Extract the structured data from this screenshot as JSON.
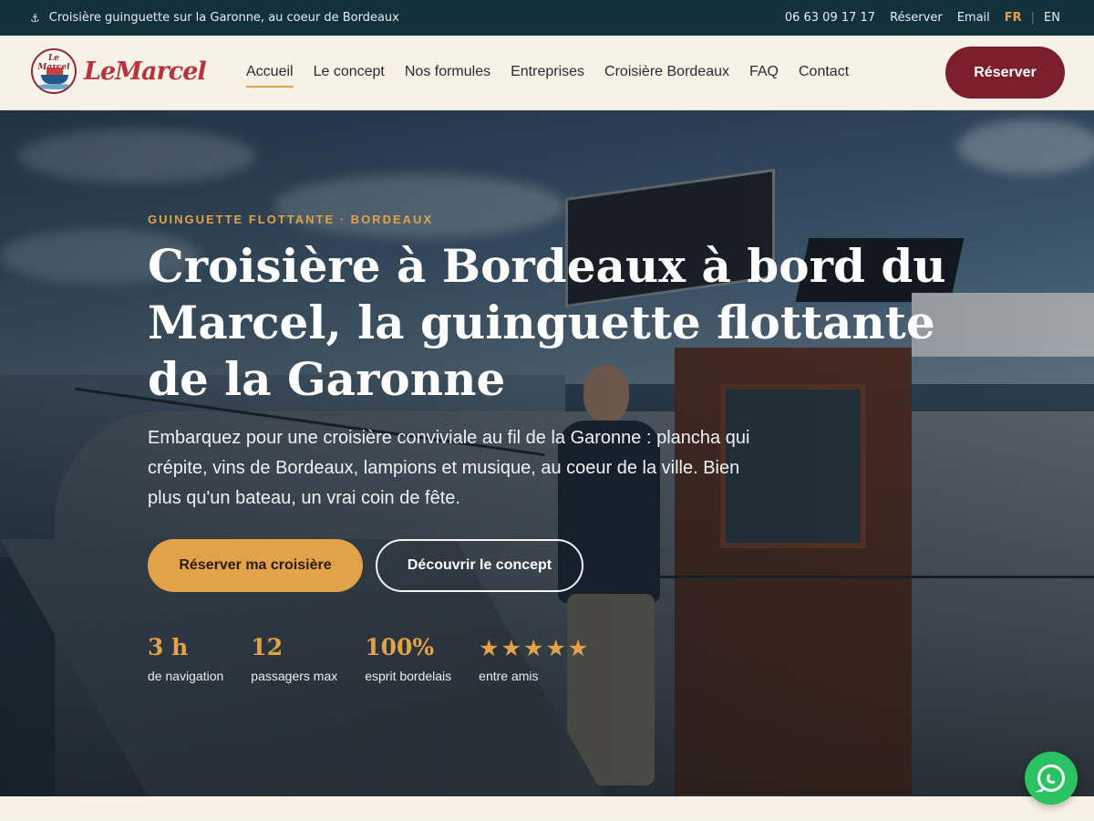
{
  "topbar": {
    "tagline": "Croisière guinguette sur la Garonne, au coeur de Bordeaux",
    "phone": "06 63 09 17 17",
    "reserve_link": "Réserver",
    "email_link": "Email",
    "lang_fr": "FR",
    "lang_sep": "|",
    "lang_en": "EN"
  },
  "header": {
    "logo_text": "LeMarcel",
    "logo_badge_text": "Le Marcel",
    "nav": [
      {
        "label": "Accueil",
        "active": true
      },
      {
        "label": "Le concept"
      },
      {
        "label": "Nos formules"
      },
      {
        "label": "Entreprises"
      },
      {
        "label": "Croisière Bordeaux"
      },
      {
        "label": "FAQ"
      },
      {
        "label": "Contact"
      }
    ],
    "cta": "Réserver"
  },
  "hero": {
    "eyebrow": "GUINGUETTE FLOTTANTE · BORDEAUX",
    "title": "Croisière à Bordeaux à bord du Marcel, la guinguette flottante de la Garonne",
    "subtitle": "Embarquez pour une croisière conviviale au fil de la Garonne : plancha qui crépite, vins de Bordeaux, lampions et musique, au coeur de la ville. Bien plus qu'un bateau, un vrai coin de fête.",
    "primary_cta": "Réserver ma croisière",
    "secondary_cta": "Découvrir le concept",
    "stats": [
      {
        "value": "3 h",
        "label": "de navigation"
      },
      {
        "value": "12",
        "label": "passagers max"
      },
      {
        "value": "100%",
        "label": "esprit bordelais"
      }
    ],
    "rating": {
      "stars": 5,
      "label": "entre amis"
    }
  },
  "colors": {
    "topbar_bg": "#13313d",
    "accent": "#e2a24a",
    "brand_red": "#7c1f2c",
    "cream": "#f8f1e6",
    "whatsapp": "#2bc263"
  },
  "icons": {
    "topbar": "anchor-icon",
    "floating": "whatsapp-icon"
  }
}
